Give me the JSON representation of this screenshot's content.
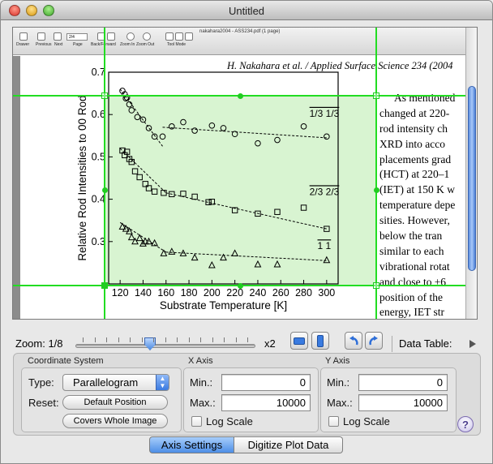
{
  "window": {
    "title": "Untitled"
  },
  "pdf_toolbar": {
    "doc_title": "nakahara2004 - ASS234.pdf (1 page)",
    "page_value": "2/4",
    "buttons": [
      "Drawer",
      "Previous",
      "Next",
      "Page",
      "Back/Forward",
      "Zoom In",
      "Zoom Out",
      "Tool Mode"
    ]
  },
  "document": {
    "header": "H. Nakahara et al. / Applied Surface Science 234 (2004",
    "body_lines": [
      "As mentioned",
      "changed at 220-",
      "rod intensity ch",
      "XRD into acco",
      "placements grad",
      "(HCT) at 220–1",
      "(IET) at 150 K w",
      "temperature depe",
      "sities. However,",
      "below the tran",
      "similar to each",
      "vibrational rotat",
      "and close to ±6",
      "position of the",
      "energy, IET str"
    ]
  },
  "chart_data": {
    "type": "scatter",
    "xlabel": "Substrate Temperature [K]",
    "ylabel": "Relative Rod Intensities to 00 Rod",
    "xlim": [
      110,
      310
    ],
    "ylim": [
      0.2,
      0.7
    ],
    "x_ticks": [
      120,
      140,
      160,
      180,
      200,
      220,
      240,
      260,
      280,
      300
    ],
    "y_ticks": [
      0.3,
      0.4,
      0.5,
      0.6,
      0.7
    ],
    "series": [
      {
        "name": "1/3 1/3",
        "marker": "circle",
        "x": [
          122,
          124,
          125,
          126,
          128,
          130,
          135,
          140,
          145,
          150,
          157,
          165,
          175,
          185,
          200,
          210,
          220,
          240,
          257,
          280,
          300
        ],
        "y": [
          0.656,
          0.648,
          0.638,
          0.64,
          0.624,
          0.61,
          0.594,
          0.588,
          0.568,
          0.548,
          0.548,
          0.572,
          0.582,
          0.562,
          0.574,
          0.568,
          0.554,
          0.532,
          0.54,
          0.572,
          0.548
        ]
      },
      {
        "name": "2/3 2/3",
        "marker": "square",
        "x": [
          122,
          124,
          126,
          128,
          130,
          133,
          137,
          142,
          145,
          150,
          158,
          165,
          175,
          185,
          197,
          200,
          220,
          240,
          257,
          280,
          300
        ],
        "y": [
          0.515,
          0.504,
          0.512,
          0.495,
          0.488,
          0.466,
          0.452,
          0.436,
          0.426,
          0.418,
          0.415,
          0.412,
          0.413,
          0.406,
          0.393,
          0.394,
          0.374,
          0.366,
          0.37,
          0.38,
          0.33
        ]
      },
      {
        "name": "1 1",
        "marker": "triangle",
        "x": [
          122,
          125,
          128,
          130,
          133,
          137,
          140,
          142,
          145,
          150,
          158,
          165,
          175,
          185,
          200,
          210,
          220,
          240,
          257,
          300
        ],
        "y": [
          0.335,
          0.33,
          0.324,
          0.31,
          0.3,
          0.308,
          0.295,
          0.3,
          0.3,
          0.296,
          0.272,
          0.276,
          0.272,
          0.262,
          0.244,
          0.262,
          0.272,
          0.246,
          0.246,
          0.256
        ]
      }
    ],
    "fits": [
      {
        "series": "1/3 1/3",
        "points": [
          [
            120,
            0.66
          ],
          [
            157,
            0.525
          ],
          [
            157,
            0.57
          ],
          [
            300,
            0.545
          ]
        ]
      },
      {
        "series": "2/3 2/3",
        "points": [
          [
            120,
            0.52
          ],
          [
            160,
            0.415
          ],
          [
            160,
            0.415
          ],
          [
            300,
            0.33
          ]
        ]
      },
      {
        "series": "1 1",
        "points": [
          [
            120,
            0.345
          ],
          [
            160,
            0.275
          ],
          [
            160,
            0.275
          ],
          [
            300,
            0.255
          ]
        ]
      }
    ],
    "labels": [
      "1/3 1/3",
      "2/3 2/3",
      "1 1"
    ]
  },
  "zoom": {
    "label": "Zoom: 1/8",
    "max_label": "x2"
  },
  "data_table_label": "Data Table:",
  "coordinate_system": {
    "title": "Coordinate System",
    "type_label": "Type:",
    "type_value": "Parallelogram",
    "reset_label": "Reset:",
    "default_position": "Default Position",
    "covers_whole_image": "Covers Whole Image"
  },
  "x_axis": {
    "title": "X Axis",
    "min_label": "Min.:",
    "min_value": "0",
    "max_label": "Max.:",
    "max_value": "10000",
    "log_label": "Log Scale"
  },
  "y_axis": {
    "title": "Y Axis",
    "min_label": "Min.:",
    "min_value": "0",
    "max_label": "Max.:",
    "max_value": "10000",
    "log_label": "Log Scale"
  },
  "tabs": {
    "axis_settings": "Axis Settings",
    "digitize": "Digitize Plot Data"
  },
  "help": "?",
  "colors": {
    "overlay_green": "#22dd22",
    "region_fill": "#c8f0be",
    "accent_blue": "#4d8ee6"
  }
}
